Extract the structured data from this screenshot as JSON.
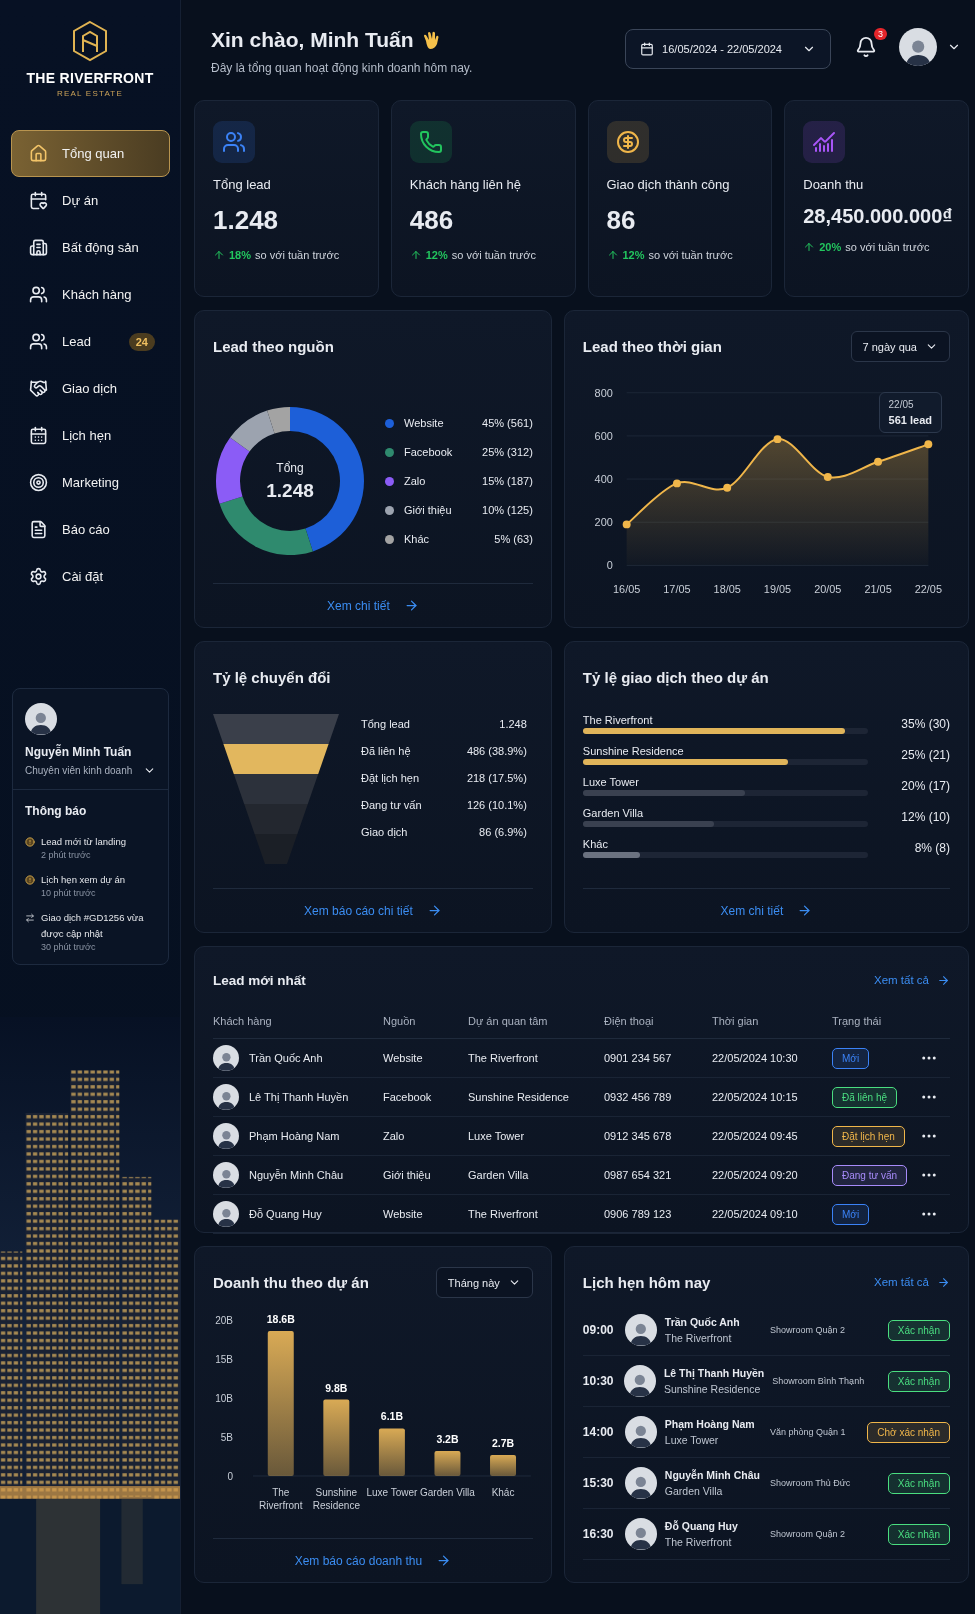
{
  "brand": {
    "name": "THE RIVERFRONT",
    "tagline": "REAL ESTATE"
  },
  "nav": [
    {
      "label": "Tổng quan",
      "selected": true
    },
    {
      "label": "Dự án",
      "selected": false
    },
    {
      "label": "Bất động sản",
      "selected": false
    },
    {
      "label": "Khách hàng",
      "selected": false
    },
    {
      "label": "Lead",
      "selected": false,
      "badge": "24"
    },
    {
      "label": "Giao dịch",
      "selected": false
    },
    {
      "label": "Lịch hẹn",
      "selected": false
    },
    {
      "label": "Marketing",
      "selected": false
    },
    {
      "label": "Báo cáo",
      "selected": false
    },
    {
      "label": "Cài đặt",
      "selected": false
    }
  ],
  "profile": {
    "name": "Nguyễn Minh Tuấn",
    "role": "Chuyên viên kinh doanh"
  },
  "notifications": {
    "title": "Thông báo",
    "items": [
      {
        "kind": "alert",
        "text": "Lead mới từ landing",
        "time": "2 phút trước"
      },
      {
        "kind": "alert",
        "text": "Lịch hẹn xem dự án",
        "time": "10 phút trước"
      },
      {
        "kind": "update",
        "text": "Giao dịch #GD1256 vừa được cập nhật",
        "time": "30 phút trước"
      }
    ]
  },
  "header": {
    "greeting": "Xin chào, Minh Tuấn",
    "subtitle": "Đây là tổng quan hoạt động kinh doanh hôm nay.",
    "date_range": "16/05/2024 - 22/05/2024",
    "notification_count": "3"
  },
  "stats": [
    {
      "label": "Tổng lead",
      "value": "1.248",
      "change": "18%",
      "note": "so với tuần trước",
      "color": "#3b82f6"
    },
    {
      "label": "Khách hàng liên hệ",
      "value": "486",
      "change": "12%",
      "note": "so với tuần trước",
      "color": "#22c55e"
    },
    {
      "label": "Giao dịch thành công",
      "value": "86",
      "change": "12%",
      "note": "so với tuần trước",
      "color": "#f0b64a"
    },
    {
      "label": "Doanh thu",
      "value": "28,450.000.000₫",
      "change": "20%",
      "note": "so với tuần trước",
      "color": "#a855f7"
    }
  ],
  "lead_sources": {
    "title": "Lead theo nguồn",
    "total_label": "Tổng",
    "total_value": "1.248",
    "legend": [
      {
        "value": "45% (561)",
        "color": "#1d5fd8"
      },
      {
        "value": "25% (312)",
        "color": "#2f8a6e"
      },
      {
        "value": "15% (187)",
        "color": "#8b5cf6"
      },
      {
        "value": "10% (125)",
        "color": "#9ca3af"
      },
      {
        "value": "5% (63)",
        "color": "#a3a3a3"
      }
    ],
    "chart_data": {
      "type": "donut",
      "categories": [
        "Website",
        "Facebook",
        "Zalo",
        "Giới thiệu",
        "Khác"
      ],
      "values": [
        45,
        25,
        15,
        10,
        5
      ]
    },
    "link": "Xem chi tiết"
  },
  "lead_time": {
    "title": "Lead theo thời gian",
    "period": "7 ngày qua",
    "tooltip": {
      "date": "22/05",
      "value": "561 lead"
    },
    "chart_data": {
      "type": "area",
      "categories": [
        "16/05",
        "17/05",
        "18/05",
        "19/05",
        "20/05",
        "21/05",
        "22/05"
      ],
      "series": [
        {
          "color": "#f0b64a",
          "values": [
            190,
            380,
            360,
            585,
            410,
            480,
            561
          ]
        }
      ],
      "grid": true,
      "ylim": [
        0,
        800
      ],
      "yticks": [
        0,
        200,
        400,
        600,
        800
      ]
    }
  },
  "conversion": {
    "title": "Tỷ lệ chuyển đổi",
    "stages": [
      {
        "label": "Tổng lead",
        "value": "1.248",
        "highlighted": false
      },
      {
        "label": "Đã liên hệ",
        "value": "486 (38.9%)",
        "highlighted": true
      },
      {
        "label": "Đặt lịch hẹn",
        "value": "218 (17.5%)",
        "highlighted": false
      },
      {
        "label": "Đang tư vấn",
        "value": "126 (10.1%)",
        "highlighted": false
      },
      {
        "label": "Giao dịch",
        "value": "86 (6.9%)",
        "highlighted": false
      }
    ],
    "link": "Xem báo cáo chi tiết"
  },
  "project_deals": {
    "title": "Tỷ lệ giao dịch theo dự án",
    "items": [
      {
        "name": "The Riverfront",
        "reading": "35% (30)",
        "level": 0.92,
        "color": "#e0b45a"
      },
      {
        "name": "Sunshine Residence",
        "reading": "25% (21)",
        "level": 0.72,
        "color": "#e0b45a"
      },
      {
        "name": "Luxe Tower",
        "reading": "20% (17)",
        "level": 0.57,
        "color": "#3a4150"
      },
      {
        "name": "Garden Villa",
        "reading": "12% (10)",
        "level": 0.46,
        "color": "#3a4150"
      },
      {
        "name": "Khác",
        "reading": "8% (8)",
        "level": 0.2,
        "color": "#6b7280"
      }
    ],
    "link": "Xem chi tiết"
  },
  "latest_leads": {
    "title": "Lead mới nhất",
    "link": "Xem tất cả",
    "columns": [
      "Khách hàng",
      "Nguồn",
      "Dự án quan tâm",
      "Điện thoại",
      "Thời gian",
      "Trạng thái"
    ],
    "rows": [
      {
        "name": "Trần Quốc Anh",
        "source": "Website",
        "project": "The Riverfront",
        "phone": "0901 234 567",
        "time": "22/05/2024 10:30",
        "status": "Mới",
        "color": "#3b82f6"
      },
      {
        "name": "Lê Thị Thanh Huyền",
        "source": "Facebook",
        "project": "Sunshine Residence",
        "phone": "0932 456 789",
        "time": "22/05/2024 10:15",
        "status": "Đã liên hệ",
        "color": "#4ade80"
      },
      {
        "name": "Phạm Hoàng Nam",
        "source": "Zalo",
        "project": "Luxe Tower",
        "phone": "0912 345 678",
        "time": "22/05/2024 09:45",
        "status": "Đặt lịch hẹn",
        "color": "#f0b64a"
      },
      {
        "name": "Nguyễn Minh Châu",
        "source": "Giới thiệu",
        "project": "Garden Villa",
        "phone": "0987 654 321",
        "time": "22/05/2024 09:20",
        "status": "Đang tư vấn",
        "color": "#a78bfa"
      },
      {
        "name": "Đỗ Quang Huy",
        "source": "Website",
        "project": "The Riverfront",
        "phone": "0906 789 123",
        "time": "22/05/2024 09:10",
        "status": "Mới",
        "color": "#3b82f6"
      }
    ]
  },
  "revenue": {
    "title": "Doanh thu theo dự án",
    "period": "Tháng này",
    "link": "Xem báo cáo doanh thu",
    "chart_data": {
      "type": "bar",
      "categories": [
        "The Riverfront",
        "Sunshine Residence",
        "Luxe Tower",
        "Garden Villa",
        "Khác"
      ],
      "series": [
        {
          "color": "#d9aa55",
          "values": [
            18.6,
            9.8,
            6.1,
            3.2,
            2.7
          ]
        }
      ],
      "ylim": [
        0,
        20
      ],
      "yticks": [
        {
          "value": 0,
          "label": "0"
        },
        {
          "value": 5,
          "label": "5B"
        },
        {
          "value": 10,
          "label": "10B"
        },
        {
          "value": 15,
          "label": "15B"
        },
        {
          "value": 20,
          "label": "20B"
        }
      ],
      "value_labels": [
        "18.6B",
        "9.8B",
        "6.1B",
        "3.2B",
        "2.7B"
      ]
    }
  },
  "appointments": {
    "title": "Lịch hẹn hôm nay",
    "link": "Xem tất cả",
    "items": [
      {
        "time": "09:00",
        "name": "Trần Quốc Anh",
        "project": "The Riverfront",
        "place": "Showroom Quận 2",
        "status": "Xác nhận",
        "color": "#4ade80"
      },
      {
        "time": "10:30",
        "name": "Lê Thị Thanh Huyền",
        "project": "Sunshine Residence",
        "place": "Showroom Bình Thạnh",
        "status": "Xác nhận",
        "color": "#4ade80"
      },
      {
        "time": "14:00",
        "name": "Phạm Hoàng Nam",
        "project": "Luxe Tower",
        "place": "Văn phòng Quận 1",
        "status": "Chờ xác nhận",
        "color": "#f0b64a"
      },
      {
        "time": "15:30",
        "name": "Nguyễn Minh Châu",
        "project": "Garden Villa",
        "place": "Showroom Thủ Đức",
        "status": "Xác nhận",
        "color": "#4ade80"
      },
      {
        "time": "16:30",
        "name": "Đỗ Quang Huy",
        "project": "The Riverfront",
        "place": "Showroom Quận 2",
        "status": "Xác nhận",
        "color": "#4ade80"
      }
    ]
  }
}
